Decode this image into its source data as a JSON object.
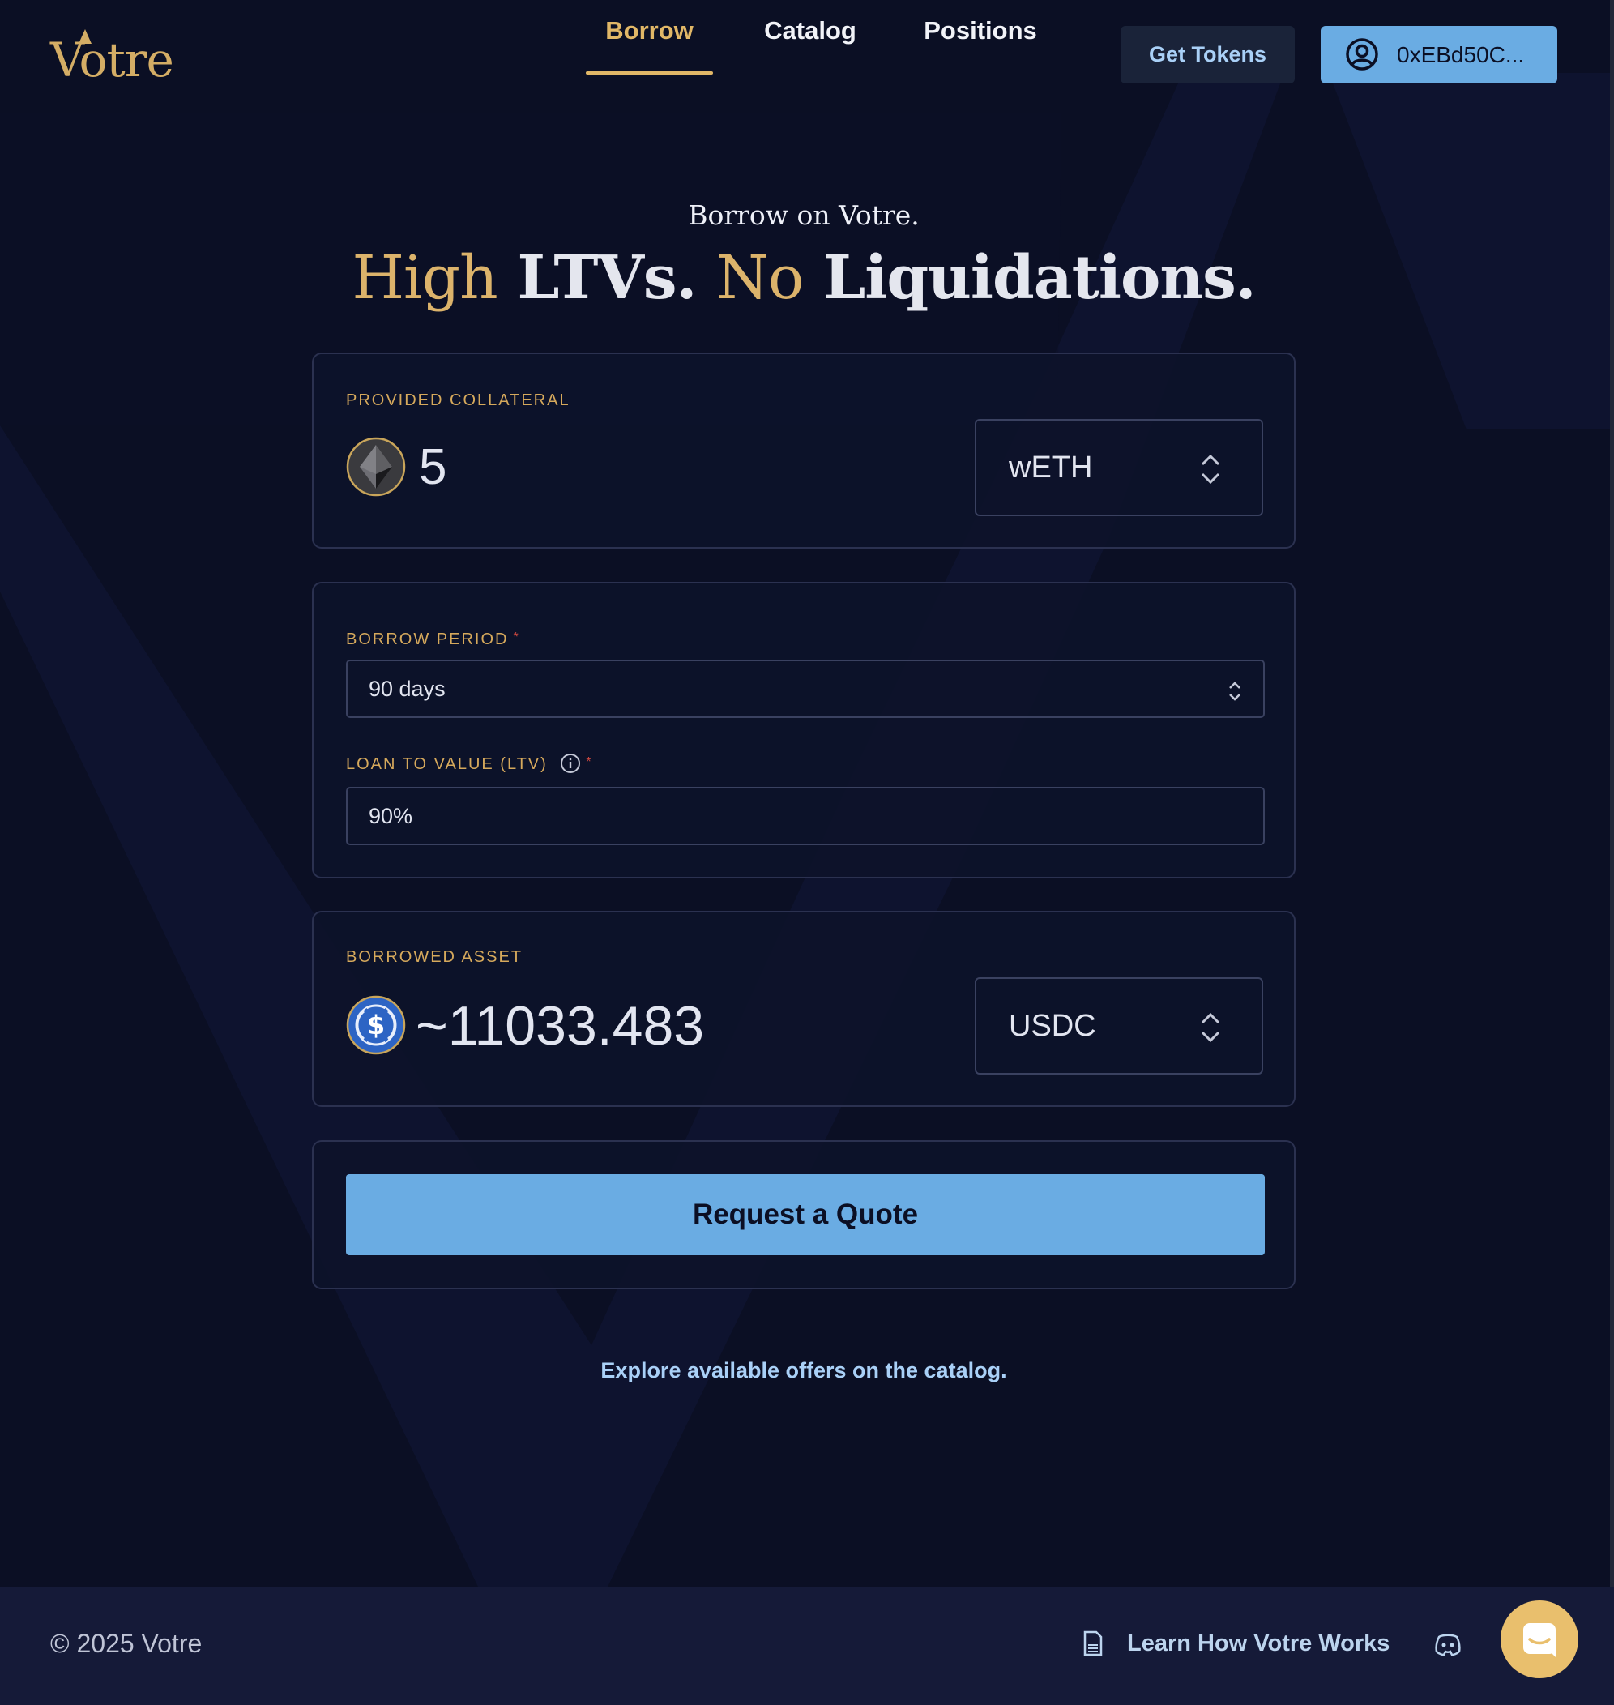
{
  "brand": {
    "logo_text": "Votre",
    "accent_color": "#dcb36b",
    "primary_button_color": "#6aace3"
  },
  "nav": {
    "items": [
      {
        "label": "Borrow",
        "active": true
      },
      {
        "label": "Catalog",
        "active": false
      },
      {
        "label": "Positions",
        "active": false
      }
    ],
    "get_tokens_label": "Get Tokens",
    "wallet_label": "0xEBd50C...",
    "wallet_icon": "user-circle-icon"
  },
  "hero": {
    "subtitle": "Borrow on Votre.",
    "title_parts": [
      "High",
      "LTVs.",
      "No",
      "Liquidations."
    ]
  },
  "collateral": {
    "label": "PROVIDED COLLATERAL",
    "amount": "5",
    "token": "wETH",
    "token_icon": "ethereum-icon"
  },
  "terms": {
    "period_label": "BORROW PERIOD",
    "period_value": "90 days",
    "ltv_label": "LOAN TO VALUE (LTV)",
    "ltv_value": "90%",
    "required_marker": "*"
  },
  "borrowed": {
    "label": "BORROWED ASSET",
    "amount": "~11033.483",
    "token": "USDC",
    "token_icon": "usdc-icon"
  },
  "actions": {
    "request_quote_label": "Request a Quote",
    "explore_link": "Explore available offers on the catalog."
  },
  "footer": {
    "copyright": "© 2025 Votre",
    "learn_link": "Learn How Votre Works"
  }
}
